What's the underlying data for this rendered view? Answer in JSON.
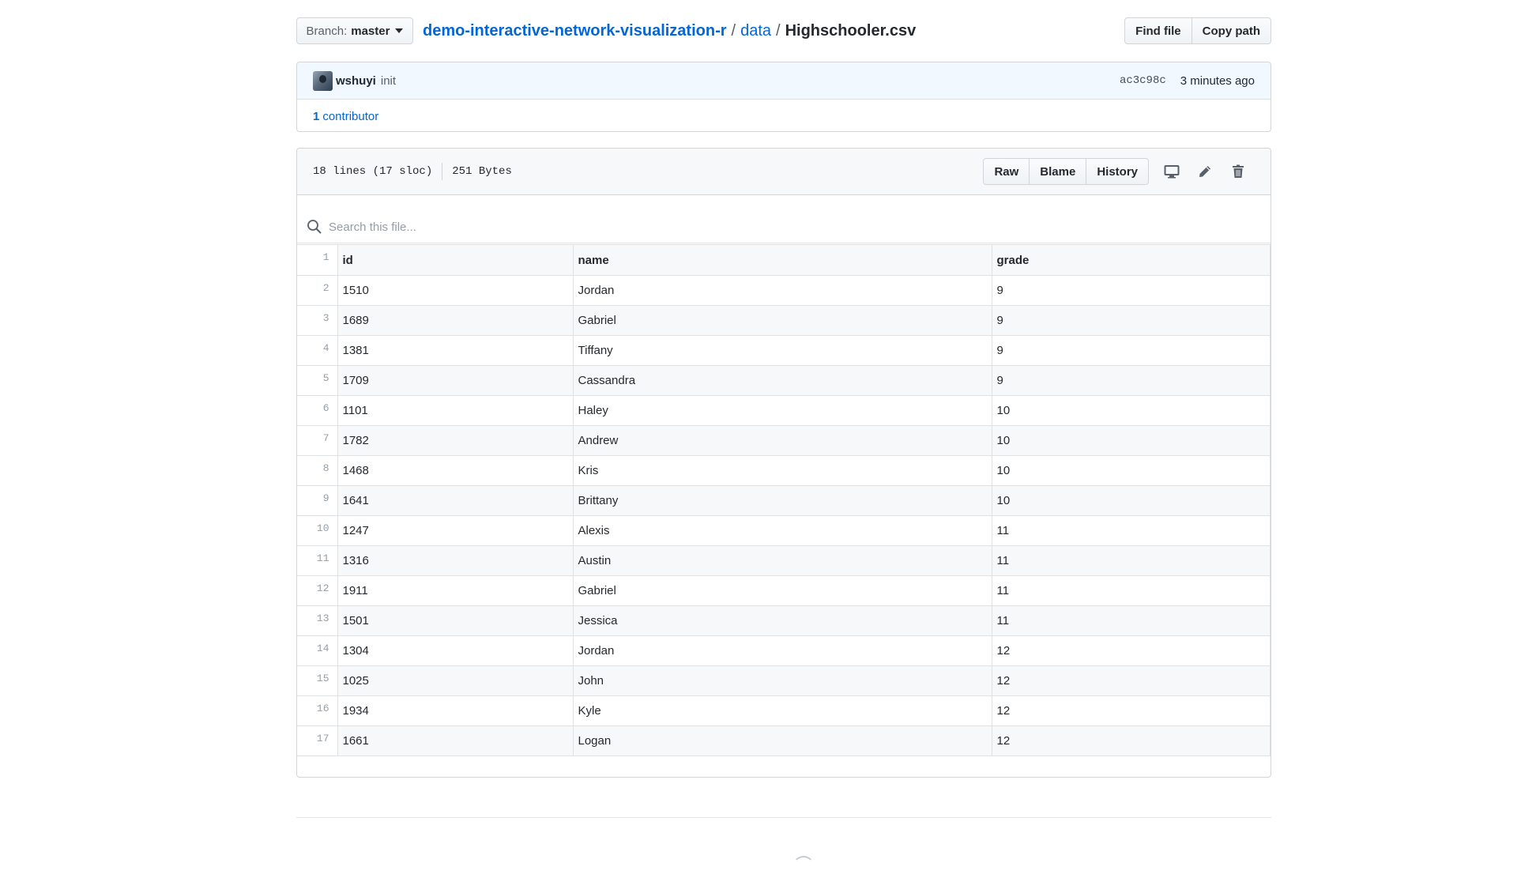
{
  "branch": {
    "label": "Branch:",
    "name": "master"
  },
  "breadcrumb": {
    "repo": "demo-interactive-network-visualization-r",
    "separator": "/",
    "folder": "data",
    "file": "Highschooler.csv"
  },
  "file_nav": {
    "find_file": "Find file",
    "copy_path": "Copy path"
  },
  "commit": {
    "author": "wshuyi",
    "message": "init",
    "sha": "ac3c98c",
    "time": "3 minutes ago"
  },
  "contributors": {
    "count": "1",
    "label": "contributor"
  },
  "file_info": {
    "lines": "18 lines (17 sloc)",
    "size": "251 Bytes"
  },
  "file_actions": {
    "raw": "Raw",
    "blame": "Blame",
    "history": "History"
  },
  "icons": {
    "desktop": "desktop-icon",
    "edit": "pencil-icon",
    "delete": "trash-icon",
    "search": "search-icon"
  },
  "search": {
    "placeholder": "Search this file..."
  },
  "table": {
    "headers": [
      "id",
      "name",
      "grade"
    ],
    "rows": [
      [
        "1510",
        "Jordan",
        "9"
      ],
      [
        "1689",
        "Gabriel",
        "9"
      ],
      [
        "1381",
        "Tiffany",
        "9"
      ],
      [
        "1709",
        "Cassandra",
        "9"
      ],
      [
        "1101",
        "Haley",
        "10"
      ],
      [
        "1782",
        "Andrew",
        "10"
      ],
      [
        "1468",
        "Kris",
        "10"
      ],
      [
        "1641",
        "Brittany",
        "10"
      ],
      [
        "1247",
        "Alexis",
        "11"
      ],
      [
        "1316",
        "Austin",
        "11"
      ],
      [
        "1911",
        "Gabriel",
        "11"
      ],
      [
        "1501",
        "Jessica",
        "11"
      ],
      [
        "1304",
        "Jordan",
        "12"
      ],
      [
        "1025",
        "John",
        "12"
      ],
      [
        "1934",
        "Kyle",
        "12"
      ],
      [
        "1661",
        "Logan",
        "12"
      ]
    ]
  }
}
